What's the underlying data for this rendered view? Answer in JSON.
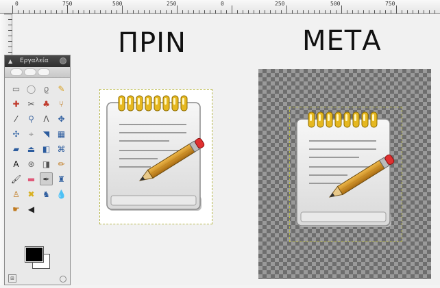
{
  "ruler": {
    "labels": [
      "0",
      "750",
      "500",
      "250",
      "0",
      "250",
      "500",
      "750"
    ]
  },
  "canvas": {
    "before_title": "ΠΡΙΝ",
    "after_title": "ΜΕΤΑ"
  },
  "toolbox": {
    "title": "Εργαλεία",
    "tools": [
      {
        "icon": "rect-select-icon",
        "glyph": "▭",
        "color": "#777"
      },
      {
        "icon": "ellipse-select-icon",
        "glyph": "◯",
        "color": "#888"
      },
      {
        "icon": "lasso-icon",
        "glyph": "ϱ",
        "color": "#777"
      },
      {
        "icon": "fuzzy-select-icon",
        "glyph": "✎",
        "color": "#d8a020"
      },
      {
        "icon": "color-select-icon",
        "glyph": "✚",
        "color": "#c0392b"
      },
      {
        "icon": "scissors-icon",
        "glyph": "✂",
        "color": "#555"
      },
      {
        "icon": "foreground-select-icon",
        "glyph": "♣",
        "color": "#c0392b"
      },
      {
        "icon": "paths-icon",
        "glyph": "⑂",
        "color": "#c07a20"
      },
      {
        "icon": "color-picker-icon",
        "glyph": "⁄",
        "color": "#333"
      },
      {
        "icon": "zoom-icon",
        "glyph": "⚲",
        "color": "#4a6fa5"
      },
      {
        "icon": "measure-icon",
        "glyph": "Ʌ",
        "color": "#555"
      },
      {
        "icon": "move-icon",
        "glyph": "✥",
        "color": "#2c5c9e"
      },
      {
        "icon": "align-icon",
        "glyph": "✣",
        "color": "#3a6aa8"
      },
      {
        "icon": "crop-icon",
        "glyph": "⌖",
        "color": "#8a8a8a"
      },
      {
        "icon": "rotate-icon",
        "glyph": "◥",
        "color": "#2c5c9e"
      },
      {
        "icon": "scale-icon",
        "glyph": "▦",
        "color": "#2c5c9e"
      },
      {
        "icon": "shear-icon",
        "glyph": "▰",
        "color": "#2c5c9e"
      },
      {
        "icon": "perspective-icon",
        "glyph": "⏏",
        "color": "#2c5c9e"
      },
      {
        "icon": "flip-icon",
        "glyph": "◧",
        "color": "#2c5c9e"
      },
      {
        "icon": "cage-icon",
        "glyph": "⌘",
        "color": "#2c5c9e"
      },
      {
        "icon": "text-icon",
        "glyph": "A",
        "color": "#111"
      },
      {
        "icon": "bucket-fill-icon",
        "glyph": "⊛",
        "color": "#666"
      },
      {
        "icon": "blend-icon",
        "glyph": "◨",
        "color": "#555"
      },
      {
        "icon": "pencil-icon",
        "glyph": "✏",
        "color": "#c07a20"
      },
      {
        "icon": "paintbrush-icon",
        "glyph": "🖌",
        "color": "#333"
      },
      {
        "icon": "eraser-icon",
        "glyph": "▬",
        "color": "#e05a7a"
      },
      {
        "icon": "airbrush-icon",
        "glyph": "✒",
        "color": "#444"
      },
      {
        "icon": "ink-icon",
        "glyph": "♜",
        "color": "#2c5c9e"
      },
      {
        "icon": "clone-icon",
        "glyph": "♙",
        "color": "#c07a20"
      },
      {
        "icon": "heal-icon",
        "glyph": "✖",
        "color": "#d8b020"
      },
      {
        "icon": "perspective-clone-icon",
        "glyph": "♞",
        "color": "#2c5c9e"
      },
      {
        "icon": "blur-icon",
        "glyph": "💧",
        "color": "#4a8ac0"
      },
      {
        "icon": "smudge-icon",
        "glyph": "☛",
        "color": "#c07a20"
      },
      {
        "icon": "dodge-burn-icon",
        "glyph": "◀",
        "color": "#222"
      }
    ],
    "active_tool_index": 26,
    "foreground_color": "#000000",
    "background_color": "#ffffff"
  },
  "colors": {
    "checker_dark": "#6e6e6e",
    "checker_light": "#9a9a9a",
    "selection_border": "#b8b84a"
  }
}
